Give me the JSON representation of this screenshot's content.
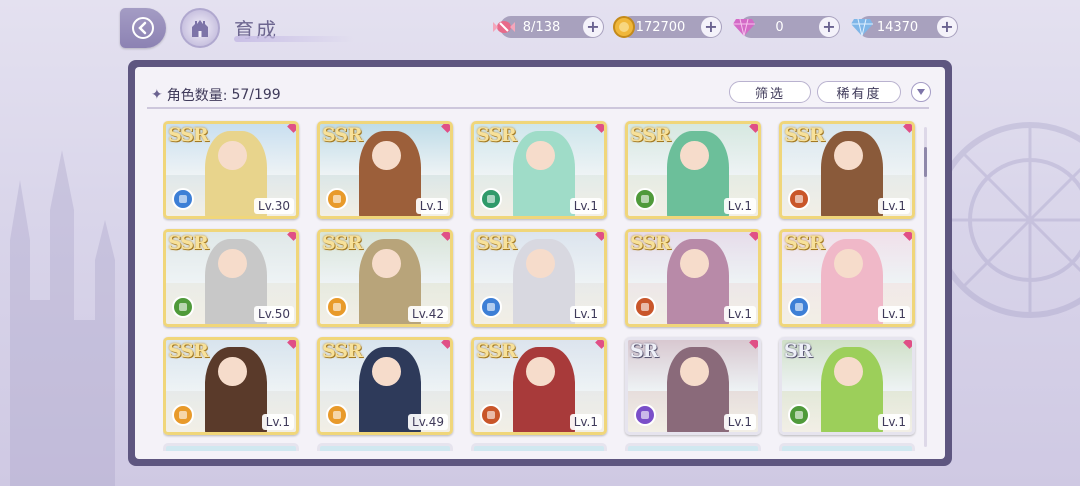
{
  "header": {
    "title": "育成"
  },
  "resources": [
    {
      "name": "candy",
      "value": "8/138",
      "icon": "candy-icon",
      "color": "#e86a8a"
    },
    {
      "name": "gold",
      "value": "172700",
      "icon": "coin-icon",
      "color": "#f0b73a"
    },
    {
      "name": "pink-gem",
      "value": "0",
      "icon": "pink-diamond-icon",
      "color": "#d46bc7"
    },
    {
      "name": "blue-gem",
      "value": "14370",
      "icon": "blue-diamond-icon",
      "color": "#7fb6e8"
    }
  ],
  "panel": {
    "count_label": "角色数量:",
    "count_value": "57/199",
    "filter_label": "筛选",
    "rarity_label": "稀有度"
  },
  "cards": [
    {
      "rarity": "SSR",
      "level": "Lv.30",
      "role_color": "#3d7fd6",
      "palette": [
        "#c9dff0",
        "#e8d48c"
      ]
    },
    {
      "rarity": "SSR",
      "level": "Lv.1",
      "role_color": "#e89a2a",
      "palette": [
        "#bfdce8",
        "#9c5f3a"
      ]
    },
    {
      "rarity": "SSR",
      "level": "Lv.1",
      "role_color": "#2f9a6a",
      "palette": [
        "#cfe6ec",
        "#9fdcc8"
      ]
    },
    {
      "rarity": "SSR",
      "level": "Lv.1",
      "role_color": "#4f9a3a",
      "palette": [
        "#d6e8e0",
        "#6cbf9a"
      ]
    },
    {
      "rarity": "SSR",
      "level": "Lv.1",
      "role_color": "#c9562a",
      "palette": [
        "#d8e6ee",
        "#8a5a3a"
      ]
    },
    {
      "rarity": "SSR",
      "level": "Lv.50",
      "role_color": "#4f9a3a",
      "palette": [
        "#e0e8e8",
        "#c8c8c8"
      ]
    },
    {
      "rarity": "SSR",
      "level": "Lv.42",
      "role_color": "#e89a2a",
      "palette": [
        "#d8e4d8",
        "#b8a47a"
      ]
    },
    {
      "rarity": "SSR",
      "level": "Lv.1",
      "role_color": "#3d7fd6",
      "palette": [
        "#dce4ee",
        "#d8d8e0"
      ]
    },
    {
      "rarity": "SSR",
      "level": "Lv.1",
      "role_color": "#c9562a",
      "palette": [
        "#e6dcea",
        "#b88aa8"
      ]
    },
    {
      "rarity": "SSR",
      "level": "Lv.1",
      "role_color": "#3d7fd6",
      "palette": [
        "#f0e0ea",
        "#f0b8c8"
      ]
    },
    {
      "rarity": "SSR",
      "level": "Lv.1",
      "role_color": "#e89a2a",
      "palette": [
        "#d8e4ee",
        "#5a3a2a"
      ]
    },
    {
      "rarity": "SSR",
      "level": "Lv.49",
      "role_color": "#e89a2a",
      "palette": [
        "#d8e4ee",
        "#2e3a5a"
      ]
    },
    {
      "rarity": "SSR",
      "level": "Lv.1",
      "role_color": "#c9562a",
      "palette": [
        "#dce4ee",
        "#a83a3a"
      ]
    },
    {
      "rarity": "SR",
      "level": "Lv.1",
      "role_color": "#7a4fc9",
      "palette": [
        "#d8c8d0",
        "#8a6a7a"
      ]
    },
    {
      "rarity": "SR",
      "level": "Lv.1",
      "role_color": "#4f9a3a",
      "palette": [
        "#d0e0c8",
        "#9ccf5a"
      ]
    }
  ]
}
